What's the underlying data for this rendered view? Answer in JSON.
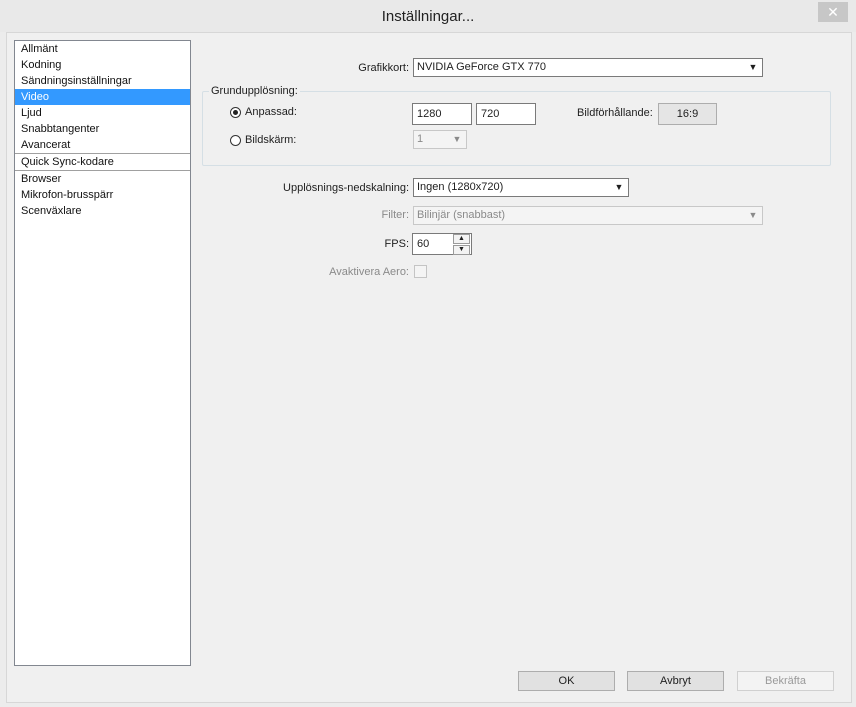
{
  "window": {
    "title": "Inställningar...",
    "close_glyph": "✕"
  },
  "nav": {
    "items": [
      {
        "label": "Allmänt"
      },
      {
        "label": "Kodning"
      },
      {
        "label": "Sändningsinställningar"
      },
      {
        "label": "Video"
      },
      {
        "label": "Ljud"
      },
      {
        "label": "Snabbtangenter"
      },
      {
        "label": "Avancerat"
      },
      {
        "label": "Quick Sync-kodare"
      },
      {
        "label": "Browser"
      },
      {
        "label": "Mikrofon-brusspärr"
      },
      {
        "label": "Scenväxlare"
      }
    ],
    "selected": "Video"
  },
  "video": {
    "gpu_label": "Grafikkort:",
    "gpu_value": "NVIDIA GeForce GTX 770",
    "base_res_label": "Grundupplösning:",
    "custom_label": "Anpassad:",
    "width": "1280",
    "height": "720",
    "aspect_label": "Bildförhållande:",
    "aspect_value": "16:9",
    "monitor_label": "Bildskärm:",
    "monitor_value": "1",
    "downscale_label": "Upplösnings-nedskalning:",
    "downscale_value": "Ingen  (1280x720)",
    "filter_label": "Filter:",
    "filter_value": "Bilinjär (snabbast)",
    "fps_label": "FPS:",
    "fps_value": "60",
    "aero_label": "Avaktivera Aero:"
  },
  "buttons": {
    "ok": "OK",
    "cancel": "Avbryt",
    "apply": "Bekräfta"
  }
}
